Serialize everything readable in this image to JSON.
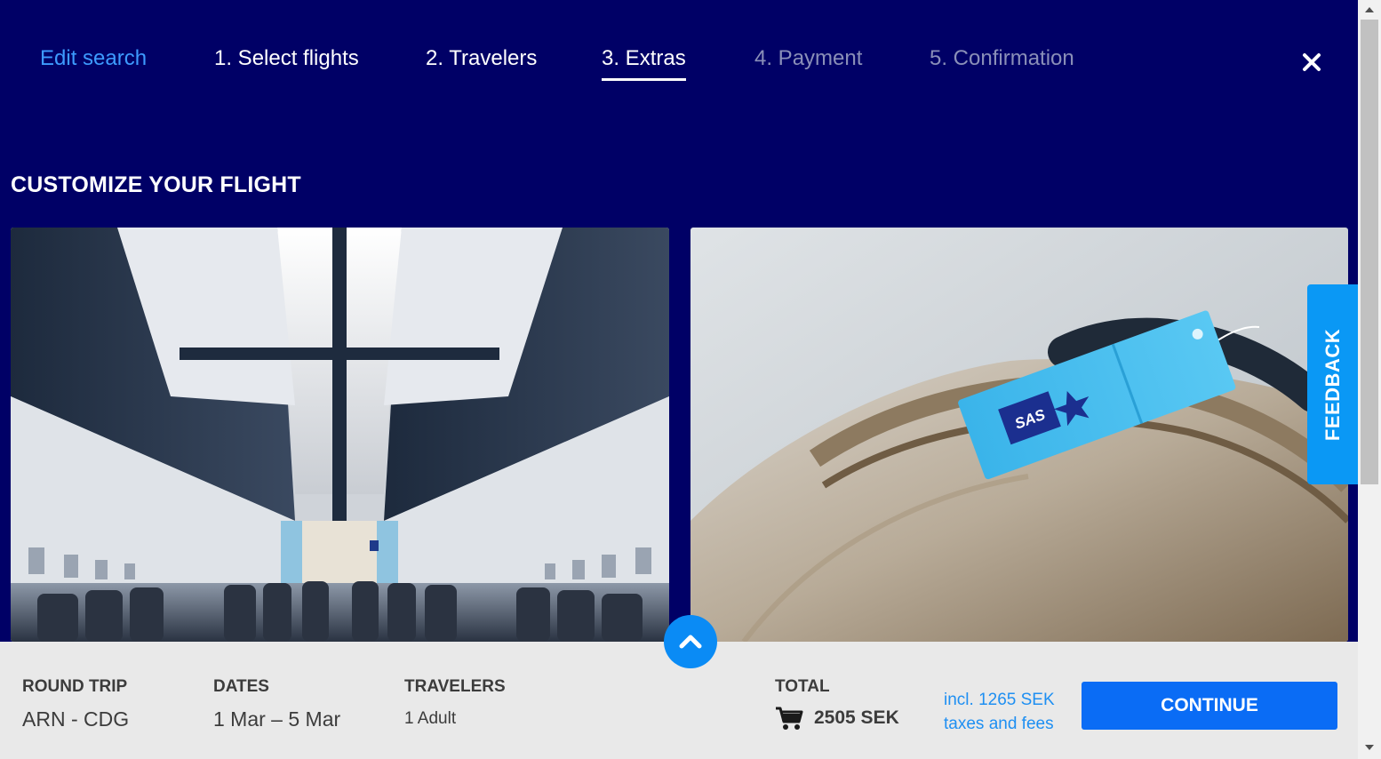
{
  "nav": {
    "edit_search": "Edit search",
    "steps": [
      "1. Select flights",
      "2. Travelers",
      "3. Extras",
      "4. Payment",
      "5. Confirmation"
    ],
    "active_step": "3. Extras",
    "close_icon": "close-icon"
  },
  "heading": "CUSTOMIZE YOUR FLIGHT",
  "cards": [
    {
      "name": "seat-selection-card",
      "image": "aircraft-cabin-interior"
    },
    {
      "name": "baggage-card",
      "image": "suitcase-with-sas-tag",
      "tag_logo": "SAS"
    }
  ],
  "feedback": {
    "label": "FEEDBACK"
  },
  "summary": {
    "trip_label": "ROUND TRIP",
    "route": "ARN - CDG",
    "dates_label": "DATES",
    "dates": "1 Mar – 5 Mar",
    "travelers_label": "TRAVELERS",
    "travelers": "1 Adult",
    "total_label": "TOTAL",
    "total_amount": "2505 SEK",
    "taxes_line1": "incl. 1265 SEK",
    "taxes_line2": "taxes and fees",
    "continue_label": "CONTINUE",
    "cart_icon": "cart-icon",
    "expand_icon": "chevron-up-icon"
  },
  "colors": {
    "background": "#000066",
    "accent": "#0a6cf5",
    "link": "#3d9bff",
    "feedback": "#0a98f5"
  }
}
